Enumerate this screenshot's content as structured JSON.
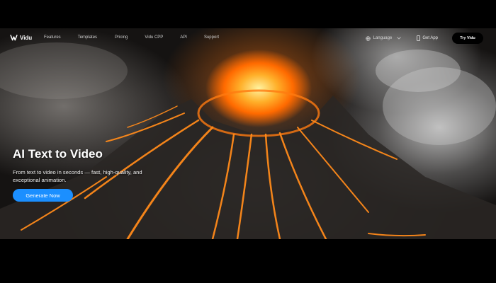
{
  "app": {
    "brand": "Vidu"
  },
  "nav": {
    "links": [
      "Features",
      "Templates",
      "Pricing",
      "Vidu CPP",
      "API",
      "Support"
    ],
    "language_label": "Language",
    "get_app_label": "Get App",
    "try_label": "Try Vidu"
  },
  "hero": {
    "title": "AI Text to Video",
    "description": "From text to video in seconds — fast, high-quality, and exceptional animation.",
    "cta_label": "Generate Now"
  },
  "colors": {
    "cta": "#1b8fff",
    "lava": "#ff6a00"
  }
}
